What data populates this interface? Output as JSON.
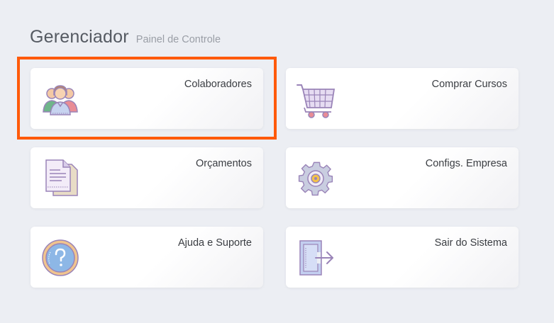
{
  "header": {
    "title": "Gerenciador",
    "subtitle": "Painel de Controle"
  },
  "cards": [
    {
      "label": "Colaboradores",
      "icon": "users-group-icon"
    },
    {
      "label": "Comprar Cursos",
      "icon": "shopping-cart-icon"
    },
    {
      "label": "Orçamentos",
      "icon": "documents-icon"
    },
    {
      "label": "Configs. Empresa",
      "icon": "gear-icon"
    },
    {
      "label": "Ajuda e Suporte",
      "icon": "help-question-icon"
    },
    {
      "label": "Sair do Sistema",
      "icon": "exit-door-icon"
    }
  ],
  "colors": {
    "highlight": "#ff5a0a",
    "background": "#eceef3",
    "icon_outline": "#9a84b8"
  }
}
